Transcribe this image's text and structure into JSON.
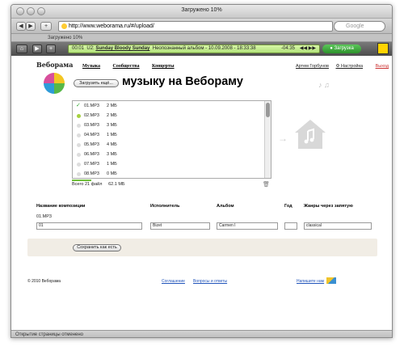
{
  "window": {
    "title": "Загружено 10%"
  },
  "toolbar": {
    "url": "http://www.weborama.ru/#/upload/",
    "search_placeholder": "Google"
  },
  "tab": {
    "label": "Загружено 10%"
  },
  "player": {
    "time": "00:01",
    "track_prefix": "U2:",
    "track_title": "Sunday Bloody Sunday",
    "track_info": "Неопознанный альбом - 10.09.2008 - 18:33:38",
    "remaining": "-04:35",
    "download_label": "Загрузка"
  },
  "site": {
    "logo_text": "Веборама",
    "nav": [
      "Музыка",
      "Сообщества",
      "Концерты"
    ],
    "user": "Артем Горбунов",
    "settings": "Настройка",
    "exit": "Выход"
  },
  "upload": {
    "button": "Загрузить ещё...",
    "heading": "музыку на Вебораму",
    "files": [
      {
        "name": "01.MP3",
        "size": "2 МБ",
        "state": "done"
      },
      {
        "name": "02.MP3",
        "size": "2 МБ",
        "state": "uploading"
      },
      {
        "name": "03.MP3",
        "size": "3 МБ",
        "state": "waiting"
      },
      {
        "name": "04.MP3",
        "size": "1 МБ",
        "state": "waiting"
      },
      {
        "name": "05.MP3",
        "size": "4 МБ",
        "state": "waiting"
      },
      {
        "name": "06.MP3",
        "size": "3 МБ",
        "state": "waiting"
      },
      {
        "name": "07.MP3",
        "size": "1 МБ",
        "state": "waiting"
      },
      {
        "name": "08.MP3",
        "size": "0 МБ",
        "state": "waiting"
      }
    ],
    "total_files": "Всего 21 файл",
    "total_size": "62.1 МБ"
  },
  "form": {
    "headers": {
      "title": "Название композиции",
      "artist": "Исполнитель",
      "album": "Альбом",
      "year": "Год",
      "genres": "Жанры через запятую"
    },
    "file_label": "01.MP3",
    "title": "01",
    "artist": "Bizet",
    "album": "Carmen I",
    "year": "",
    "genres": "classical",
    "save": "Сохранить как есть"
  },
  "footer": {
    "copyright": "© 2010 Веборама",
    "agreement": "Соглашение",
    "faq": "Вопросы и ответы",
    "write": "Напишите нам"
  },
  "status": {
    "text": "Открытие страницы отменено"
  }
}
